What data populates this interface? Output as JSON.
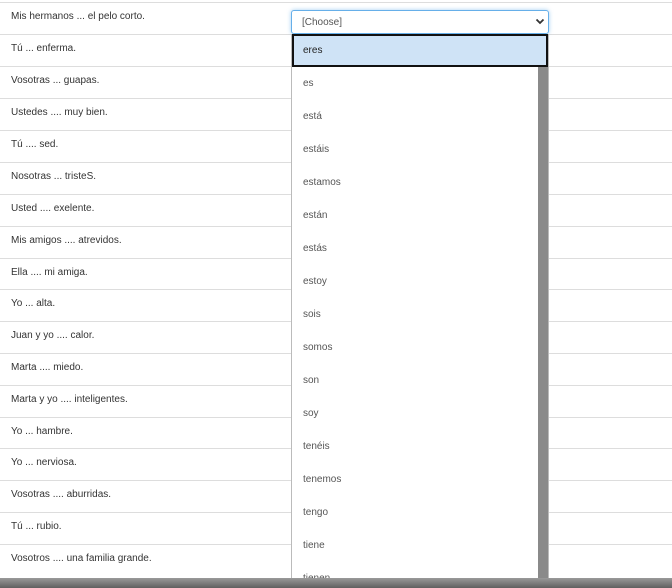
{
  "questions": [
    "Mis hermanos ... el pelo corto.",
    "Tú ... enferma.",
    "Vosotras ... guapas.",
    "Ustedes .... muy bien.",
    "Tú .... sed.",
    "Nosotras ... tristeS.",
    "Usted .... exelente.",
    "Mis amigos .... atrevidos.",
    "Ella .... mi amiga.",
    "Yo ... alta.",
    "Juan y yo .... calor.",
    "Marta .... miedo.",
    "Marta y yo .... inteligentes.",
    "Yo ... hambre.",
    "Yo ... nerviosa.",
    "Vosotras .... aburridas.",
    "Tú ... rubio.",
    "Vosotros .... una familia grande."
  ],
  "select": {
    "value": "[Choose]"
  },
  "options": [
    "eres",
    "es",
    "está",
    "estáis",
    "estamos",
    "están",
    "estás",
    "estoy",
    "sois",
    "somos",
    "son",
    "soy",
    "tenéis",
    "tenemos",
    "tengo",
    "tiene",
    "tienen"
  ],
  "highlighted_option": "eres"
}
